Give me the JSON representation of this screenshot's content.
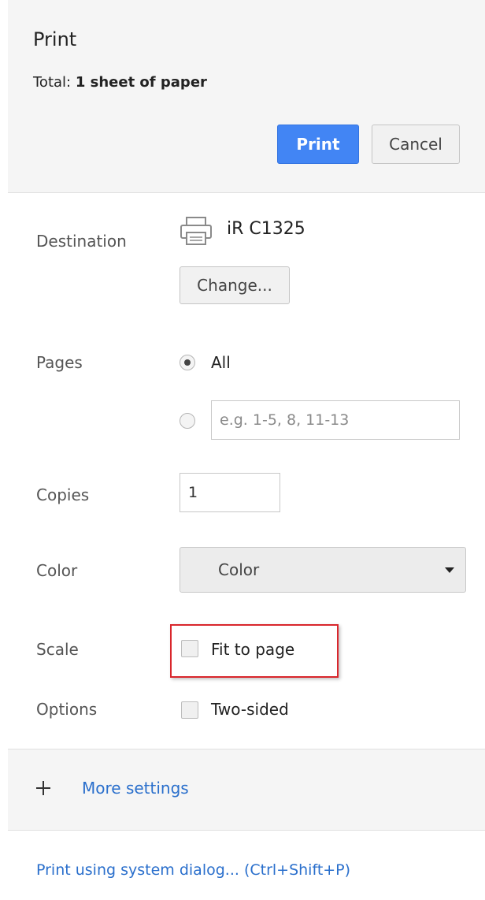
{
  "header": {
    "title": "Print",
    "total_prefix": "Total: ",
    "total_value": "1 sheet of paper",
    "print_button": "Print",
    "cancel_button": "Cancel"
  },
  "destination": {
    "label": "Destination",
    "printer_name": "iR C1325",
    "change_button": "Change..."
  },
  "pages": {
    "label": "Pages",
    "all_option": "All",
    "all_selected": true,
    "range_placeholder": "e.g. 1-5, 8, 11-13"
  },
  "copies": {
    "label": "Copies",
    "value": "1"
  },
  "color": {
    "label": "Color",
    "selected": "Color"
  },
  "scale": {
    "label": "Scale",
    "fit_to_page_label": "Fit to page",
    "fit_to_page_checked": false
  },
  "options": {
    "label": "Options",
    "two_sided_label": "Two-sided",
    "two_sided_checked": false
  },
  "more_settings": {
    "label": "More settings"
  },
  "system_dialog": {
    "label": "Print using system dialog... (Ctrl+Shift+P)"
  },
  "colors": {
    "primary": "#4285f4",
    "link": "#2a6fcc",
    "highlight": "#d9262c"
  },
  "icons": {
    "printer": "printer-icon",
    "plus": "plus-icon",
    "dropdown": "chevron-down-icon"
  }
}
